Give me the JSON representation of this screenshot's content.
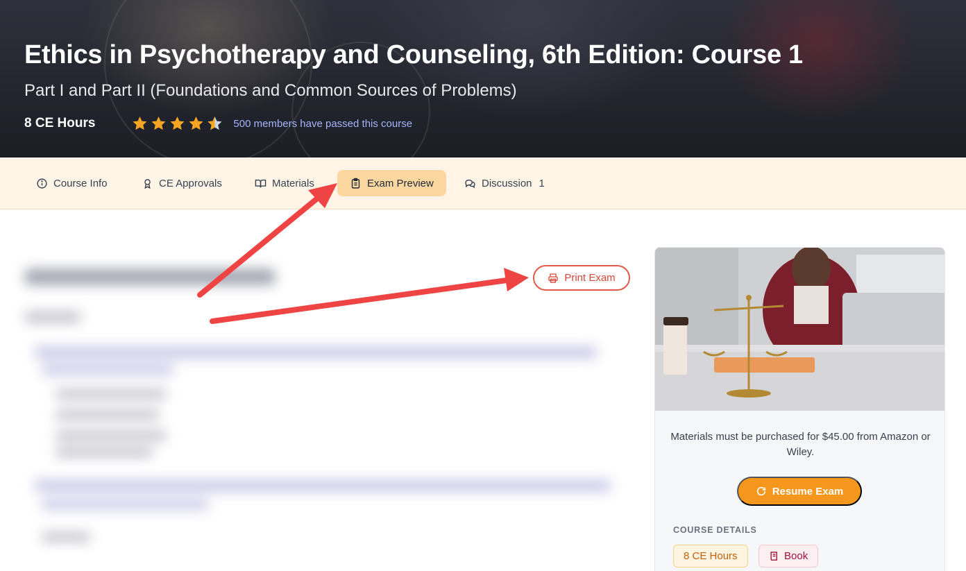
{
  "course": {
    "title": "Ethics in Psychotherapy and Counseling, 6th Edition: Course 1",
    "subtitle": "Part I and Part II (Foundations and Common Sources of Problems)",
    "ce_hours": "8 CE Hours",
    "rating": 4.5,
    "passed_text": "500 members have passed this course"
  },
  "tabs": [
    {
      "label": "Course Info",
      "icon": "info-circle-icon"
    },
    {
      "label": "CE Approvals",
      "icon": "award-icon"
    },
    {
      "label": "Materials",
      "icon": "book-open-icon"
    },
    {
      "label": "Exam Preview",
      "icon": "clipboard-icon",
      "active": true
    },
    {
      "label": "Discussion",
      "icon": "chat-bubbles-icon",
      "count": "1"
    }
  ],
  "exam": {
    "print_label": "Print Exam"
  },
  "sidebar": {
    "materials_note": "Materials must be purchased for $45.00 from Amazon or Wiley.",
    "resume_label": "Resume Exam",
    "details_heading": "COURSE DETAILS",
    "badges": {
      "hours": "8 CE Hours",
      "book": "Book"
    }
  },
  "colors": {
    "accent_orange": "#f5961d",
    "active_tab": "#fcd7a0",
    "tab_bar": "#fff4e6",
    "print_red": "#e05a4a",
    "annotation_arrow": "#ef4444",
    "link": "#a5b4fc"
  }
}
